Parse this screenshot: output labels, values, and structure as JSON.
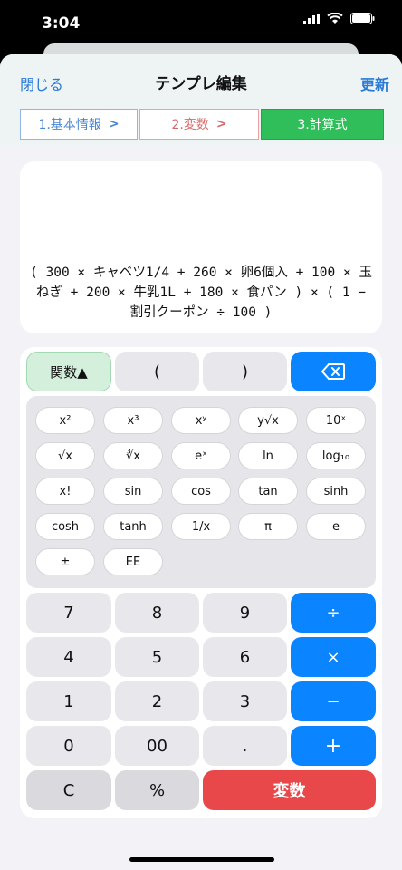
{
  "status": {
    "time": "3:04"
  },
  "nav": {
    "close": "閉じる",
    "title": "テンプレ編集",
    "update": "更新"
  },
  "steps": [
    {
      "label": "1.基本情報",
      "chevron": ">"
    },
    {
      "label": "2.変数",
      "chevron": ">"
    },
    {
      "label": "3.計算式"
    }
  ],
  "formula": "( 300 × キャベツ1/4 + 260 × 卵6個入 + 100 × 玉ねぎ + 200 × 牛乳1L + 180 × 食パン ) × ( 1 − 割引クーポン ÷ 100 )",
  "keypad": {
    "top_row": [
      "関数▲",
      "(",
      ")"
    ],
    "functions": [
      "x²",
      "x³",
      "xʸ",
      "y√x",
      "10ˣ",
      "√x",
      "∛x",
      "eˣ",
      "ln",
      "log₁₀",
      "x!",
      "sin",
      "cos",
      "tan",
      "sinh",
      "cosh",
      "tanh",
      "1/x",
      "π",
      "e",
      "±",
      "EE"
    ],
    "numbers": [
      "7",
      "8",
      "9",
      "4",
      "5",
      "6",
      "1",
      "2",
      "3",
      "0",
      "00",
      "."
    ],
    "operators": [
      "÷",
      "×",
      "−",
      "+"
    ],
    "bottom": [
      "C",
      "%",
      "変数"
    ]
  },
  "colors": {
    "accent": "#0a84ff",
    "green": "#2fbe5a",
    "red": "#e8484a"
  }
}
